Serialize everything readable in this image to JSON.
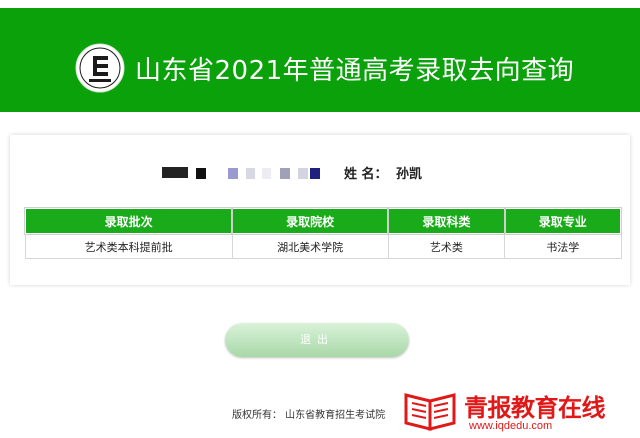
{
  "header": {
    "title": "山东省2021年普通高考录取去向查询",
    "logo_icon": "exam-institute-logo-icon"
  },
  "student": {
    "name_label": "姓 名：",
    "name": "孙凯"
  },
  "table": {
    "headers": [
      "录取批次",
      "录取院校",
      "录取科类",
      "录取专业"
    ],
    "rows": [
      [
        "艺术类本科提前批",
        "湖北美术学院",
        "艺术类",
        "书法学"
      ]
    ]
  },
  "exit_label": "退出",
  "footer": "版权所有：  山东省教育招生考试院",
  "watermark": {
    "brand": "青报教育在线",
    "url": "www.iqdedu.com",
    "icon": "open-book-icon"
  },
  "colors": {
    "header_green": "#0aa10a",
    "table_header_green": "#19ab19",
    "watermark_red": "#e01818"
  }
}
